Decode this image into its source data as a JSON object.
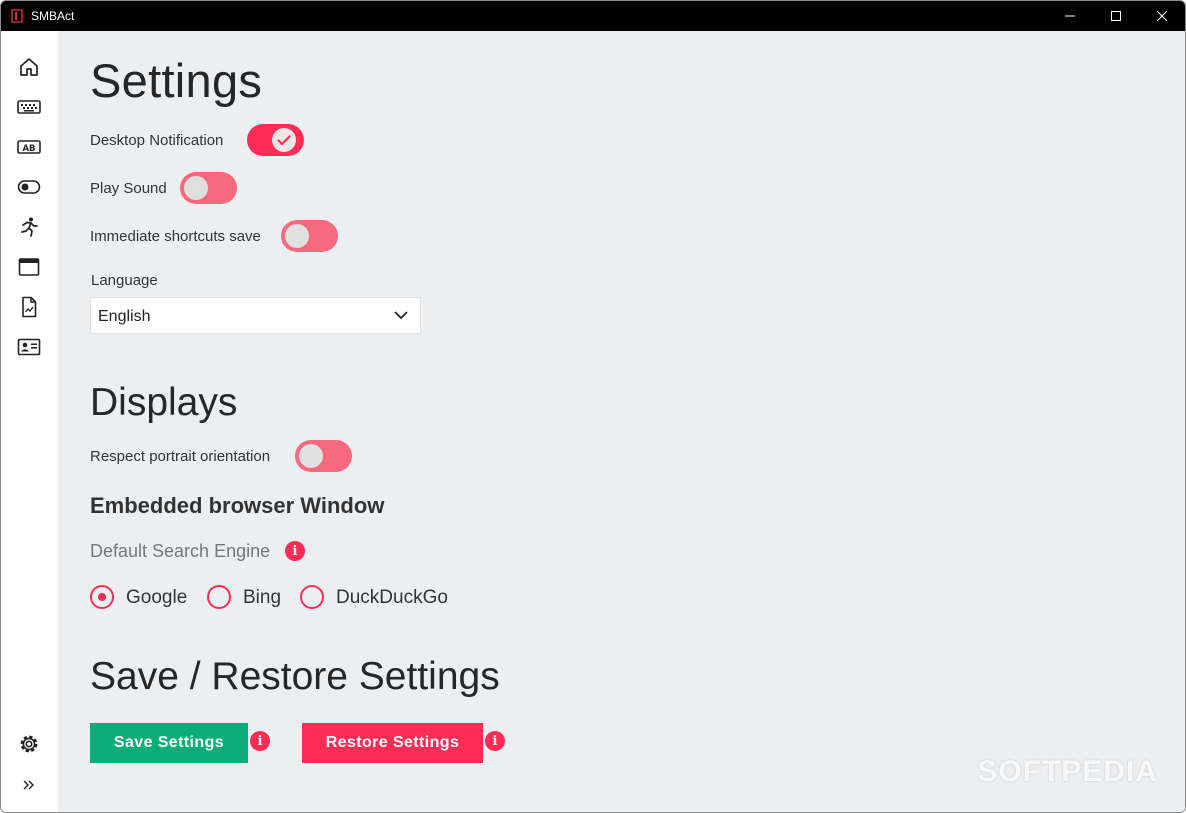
{
  "window": {
    "title": "SMBAct"
  },
  "sidebar": {
    "items": [
      {
        "icon": "home-icon"
      },
      {
        "icon": "keyboard-icon"
      },
      {
        "icon": "text-ab-icon"
      },
      {
        "icon": "toggle-icon"
      },
      {
        "icon": "running-person-icon"
      },
      {
        "icon": "browser-window-icon"
      },
      {
        "icon": "document-chart-icon"
      },
      {
        "icon": "contact-card-icon"
      }
    ],
    "bottom": [
      {
        "icon": "gear-icon"
      },
      {
        "icon": "expand-chevrons-icon"
      }
    ]
  },
  "settings": {
    "title": "Settings",
    "desktop_notification": {
      "label": "Desktop Notification",
      "on": true
    },
    "play_sound": {
      "label": "Play Sound",
      "on": false
    },
    "immediate_save": {
      "label": "Immediate shortcuts save",
      "on": false
    },
    "language": {
      "label": "Language",
      "value": "English"
    }
  },
  "displays": {
    "title": "Displays",
    "portrait": {
      "label": "Respect portrait orientation",
      "on": false
    }
  },
  "browser": {
    "title": "Embedded browser Window",
    "search_label": "Default Search Engine",
    "engines": [
      {
        "label": "Google",
        "selected": true
      },
      {
        "label": "Bing",
        "selected": false
      },
      {
        "label": "DuckDuckGo",
        "selected": false
      }
    ]
  },
  "save_restore": {
    "title": "Save / Restore Settings",
    "save_label": "Save Settings",
    "restore_label": "Restore Settings",
    "info_glyph": "i"
  },
  "watermark": "SOFTPEDIA",
  "colors": {
    "accent": "#ff2d55",
    "save": "#0aad77",
    "background": "#eceff2"
  }
}
